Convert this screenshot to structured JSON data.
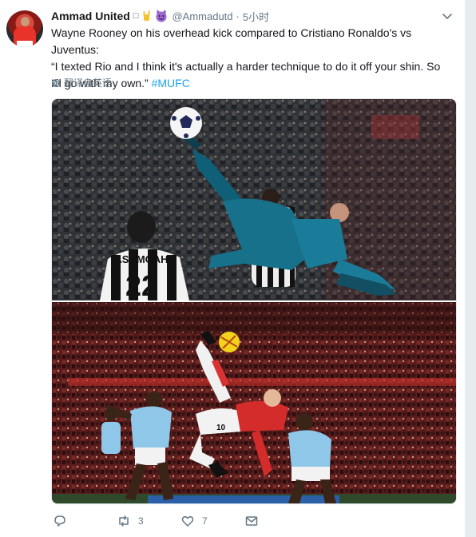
{
  "tweet": {
    "author_name": "Ammad United",
    "author_badge": "\u0000",
    "handle": "@Ammadutd",
    "separator": "·",
    "time": "5小时",
    "text_line1": "Wayne Rooney on his overhead kick compared to Cristiano Ronaldo's vs Juventus:",
    "text_line2": "“I texted Rio and I think it's actually a harder technique to do it off your shin. So",
    "text_line3": "I'll go with my own.” ",
    "hashtag": "#MUFC",
    "translate_label": "翻译自英语",
    "photo1_jersey_name": "ASAMOAH",
    "photo1_jersey_number": "22",
    "photo2_shirt_number": "10",
    "retweet_count": "3",
    "like_count": "7"
  },
  "icons": {
    "caret": "chevron-down-icon",
    "reply": "reply-icon",
    "retweet": "retweet-icon",
    "like": "heart-icon",
    "dm": "envelope-icon",
    "translate": "globe-icon"
  },
  "colors": {
    "accent": "#1da1f2",
    "secondary_text": "#657786",
    "background": "#e6ecf0"
  }
}
